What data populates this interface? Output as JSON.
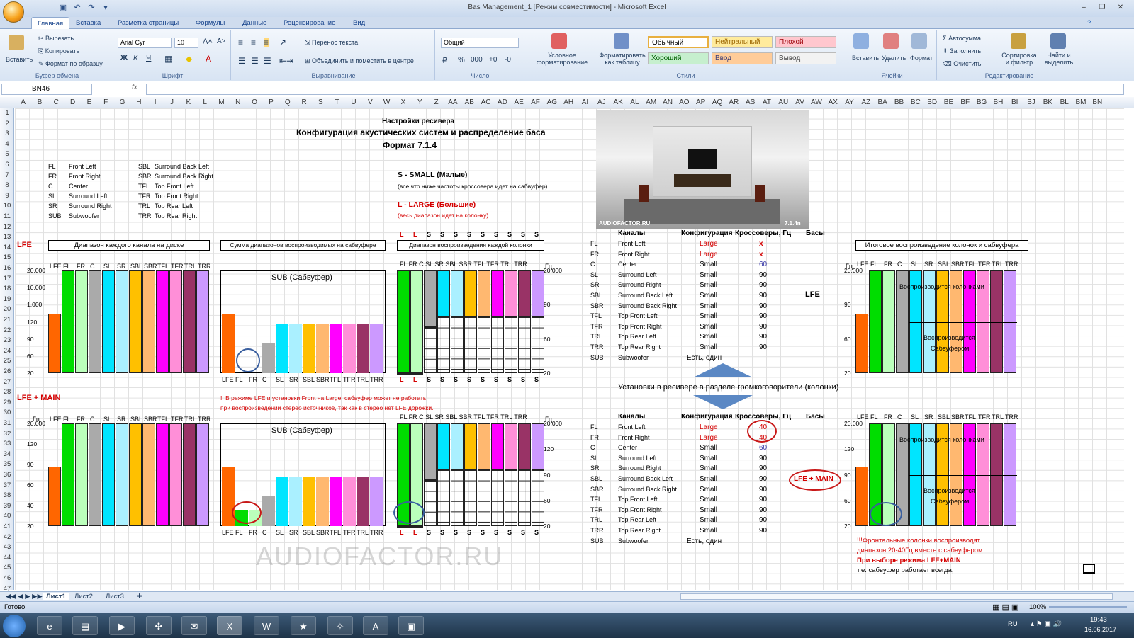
{
  "window": {
    "title": "Bas Management_1  [Режим совместимости] - Microsoft Excel"
  },
  "tabs": [
    "Главная",
    "Вставка",
    "Разметка страницы",
    "Формулы",
    "Данные",
    "Рецензирование",
    "Вид"
  ],
  "ribbon": {
    "clipboard": {
      "paste": "Вставить",
      "cut": "Вырезать",
      "copy": "Копировать",
      "format_painter": "Формат по образцу",
      "label": "Буфер обмена"
    },
    "font": {
      "name": "Arial Cyr",
      "size": "10",
      "bold": "Ж",
      "italic": "К",
      "underline": "Ч",
      "label": "Шрифт"
    },
    "alignment": {
      "wrap": "Перенос текста",
      "merge": "Объединить и поместить в центре",
      "label": "Выравнивание"
    },
    "number": {
      "format": "Общий",
      "label": "Число"
    },
    "styles": {
      "conditional": "Условное форматирование",
      "as_table": "Форматировать как таблицу",
      "normal": "Обычный",
      "neutral": "Нейтральный",
      "bad": "Плохой",
      "good": "Хороший",
      "input": "Ввод",
      "output": "Вывод",
      "label": "Стили"
    },
    "cells": {
      "insert": "Вставить",
      "delete": "Удалить",
      "format": "Формат",
      "label": "Ячейки"
    },
    "editing": {
      "autosum": "Автосумма",
      "fill": "Заполнить",
      "clear": "Очистить",
      "sort": "Сортировка и фильтр",
      "find": "Найти и выделить",
      "label": "Редактирование"
    }
  },
  "formula_bar": {
    "name_box": "BN46",
    "fx": "fx"
  },
  "columns": [
    "A",
    "B",
    "C",
    "D",
    "E",
    "F",
    "G",
    "H",
    "I",
    "J",
    "K",
    "L",
    "M",
    "N",
    "O",
    "P",
    "Q",
    "R",
    "S",
    "T",
    "U",
    "V",
    "W",
    "X",
    "Y",
    "Z",
    "AA",
    "AB",
    "AC",
    "AD",
    "AE",
    "AF",
    "AG",
    "AH",
    "AI",
    "AJ",
    "AK",
    "AL",
    "AM",
    "AN",
    "AO",
    "AP",
    "AQ",
    "AR",
    "AS",
    "AT",
    "AU",
    "AV",
    "AW",
    "AX",
    "AY",
    "AZ",
    "BA",
    "BB",
    "BC",
    "BD",
    "BE",
    "BF",
    "BG",
    "BH",
    "BI",
    "BJ",
    "BK",
    "BL",
    "BM",
    "BN"
  ],
  "rows": [
    "1",
    "2",
    "3",
    "4",
    "5",
    "6",
    "7",
    "8",
    "9",
    "10",
    "11",
    "12",
    "13",
    "14",
    "15",
    "16",
    "17",
    "18",
    "19",
    "20",
    "21",
    "22",
    "23",
    "24",
    "25",
    "26",
    "27",
    "28",
    "29",
    "30",
    "31",
    "32",
    "33",
    "34",
    "35",
    "36",
    "37",
    "38",
    "39",
    "40",
    "41",
    "42",
    "43",
    "44",
    "45",
    "46",
    "47"
  ],
  "content": {
    "header1": "Настройки ресивера",
    "header2": "Конфигурация акустических систем и распределение баса",
    "header3": "Формат 7.1.4",
    "legend_left": [
      [
        "FL",
        "Front Left"
      ],
      [
        "FR",
        "Front Right"
      ],
      [
        "C",
        "Center"
      ],
      [
        "SL",
        "Surround Left"
      ],
      [
        "SR",
        "Surround Right"
      ],
      [
        "SUB",
        "Subwoofer"
      ]
    ],
    "legend_right": [
      [
        "SBL",
        "Surround Back Left"
      ],
      [
        "SBR",
        "Surround Back Right"
      ],
      [
        "TFL",
        "Top Front Left"
      ],
      [
        "TFR",
        "Top Front Right"
      ],
      [
        "TRL",
        "Top Rear Left"
      ],
      [
        "TRR",
        "Top Rear Right"
      ]
    ],
    "small_label": "S   -   SMALL (Малые)",
    "small_desc": "(все что ниже частоты кроссовера идет на сабвуфер)",
    "large_label": "L   -   LARGE (Большие)",
    "large_desc": "(весь диапазон идет на колонку)",
    "lfe": "LFE",
    "lfe_main": "LFE + MAIN",
    "box_disk": "Диапазон каждого канала на диске",
    "box_sub": "Сумма диапазонов воспроизводимых на сабвуфере",
    "box_each": "Диапазон воспроизведения каждой колонки",
    "box_final": "Итоговое воспроизведение колонок и сабвуфера",
    "sub_title": "SUB (Сабвуфер)",
    "channels": [
      "LFE",
      "FL",
      "FR",
      "C",
      "SL",
      "SR",
      "SBL",
      "SBR",
      "TFL",
      "TFR",
      "TRL",
      "TRR"
    ],
    "sizes": [
      "L",
      "L",
      "S",
      "S",
      "S",
      "S",
      "S",
      "S",
      "S",
      "S",
      "S"
    ],
    "speaker_cols": [
      "FL",
      "FR",
      "C",
      "SL",
      "SR",
      "SBL",
      "SBR",
      "TFL",
      "TFR",
      "TRL",
      "TRR"
    ],
    "hz_unit": "Гц",
    "freq_top": [
      "20.000",
      "10.000",
      "1.000",
      "120",
      "90",
      "60",
      "20"
    ],
    "freq_bot": [
      "20.000",
      "120",
      "90",
      "60",
      "40",
      "20"
    ],
    "freq_mid_top": [
      "20.000",
      "90",
      "60",
      "20"
    ],
    "freq_mid_bot": [
      "20.000",
      "120",
      "90",
      "60",
      "20"
    ],
    "table_headers": [
      "Каналы",
      "Конфигурация",
      "Кроссоверы, Гц",
      "Басы"
    ],
    "table1": [
      [
        "FL",
        "Front Left",
        "Large",
        "x"
      ],
      [
        "FR",
        "Front Right",
        "Large",
        "x"
      ],
      [
        "C",
        "Center",
        "Small",
        "60"
      ],
      [
        "SL",
        "Surround Left",
        "Small",
        "90"
      ],
      [
        "SR",
        "Surround Right",
        "Small",
        "90"
      ],
      [
        "SBL",
        "Surround Back Left",
        "Small",
        "90"
      ],
      [
        "SBR",
        "Surround Back Right",
        "Small",
        "90"
      ],
      [
        "TFL",
        "Top Front Left",
        "Small",
        "90"
      ],
      [
        "TFR",
        "Top Front Right",
        "Small",
        "90"
      ],
      [
        "TRL",
        "Top Rear Left",
        "Small",
        "90"
      ],
      [
        "TRR",
        "Top Rear Right",
        "Small",
        "90"
      ],
      [
        "SUB",
        "Subwoofer",
        "Есть, один",
        ""
      ]
    ],
    "table2": [
      [
        "FL",
        "Front Left",
        "Large",
        "40"
      ],
      [
        "FR",
        "Front Right",
        "Large",
        "40"
      ],
      [
        "C",
        "Center",
        "Small",
        "60"
      ],
      [
        "SL",
        "Surround Left",
        "Small",
        "90"
      ],
      [
        "SR",
        "Surround Right",
        "Small",
        "90"
      ],
      [
        "SBL",
        "Surround Back Left",
        "Small",
        "90"
      ],
      [
        "SBR",
        "Surround Back Right",
        "Small",
        "90"
      ],
      [
        "TFL",
        "Top Front Left",
        "Small",
        "90"
      ],
      [
        "TFR",
        "Top Front Right",
        "Small",
        "90"
      ],
      [
        "TRL",
        "Top Rear Left",
        "Small",
        "90"
      ],
      [
        "TRR",
        "Top Rear Right",
        "Small",
        "90"
      ],
      [
        "SUB",
        "Subwoofer",
        "Есть, один",
        ""
      ]
    ],
    "bass_lfe": "LFE",
    "bass_lfe_main": "LFE + MAIN",
    "receiver_setup": "Установки в ресивере в разделе громкоговорители (колонки)",
    "warning1": "!! В режиме LFE и установки Front на Large, сабвуфер может не работать",
    "warning2": "при воспроизведении стерео источников, так как в стерео нет LFE дорожки.",
    "plays_speakers": "Воспроизводится колонками",
    "plays_sub1": "Воспроизводится",
    "plays_sub2": "Сабвуфером",
    "note1": "!!!Фронтальные колонки воспроизводят",
    "note2": "диапазон 20-40Гц вместе с сабвуфером.",
    "note3": "При выборе режима LFE+MAIN",
    "note4": "т.е. сабвуфер работает всегда,",
    "watermark": "AUDIOFACTOR.RU",
    "img_logo": "AUDIOFACTOR.RU",
    "img_format": "7.1.4n"
  },
  "sheet_tabs": [
    "Лист1",
    "Лист2",
    "Лист3"
  ],
  "status": {
    "ready": "Готово",
    "zoom": "100%"
  },
  "taskbar": {
    "lang": "RU",
    "time": "19:43",
    "date": "16.06.2017"
  },
  "colors": {
    "lfe": "#ff6600",
    "fl": "#00dd00",
    "fr": "#bbffbb",
    "c": "#aaaaaa",
    "sl": "#00e5ff",
    "sr": "#aaf0ff",
    "sbl": "#ffc000",
    "sbr": "#ffb870",
    "tfl": "#ff00ff",
    "tfr": "#ff8fd8",
    "trl": "#993366",
    "trr": "#cc99ff"
  }
}
